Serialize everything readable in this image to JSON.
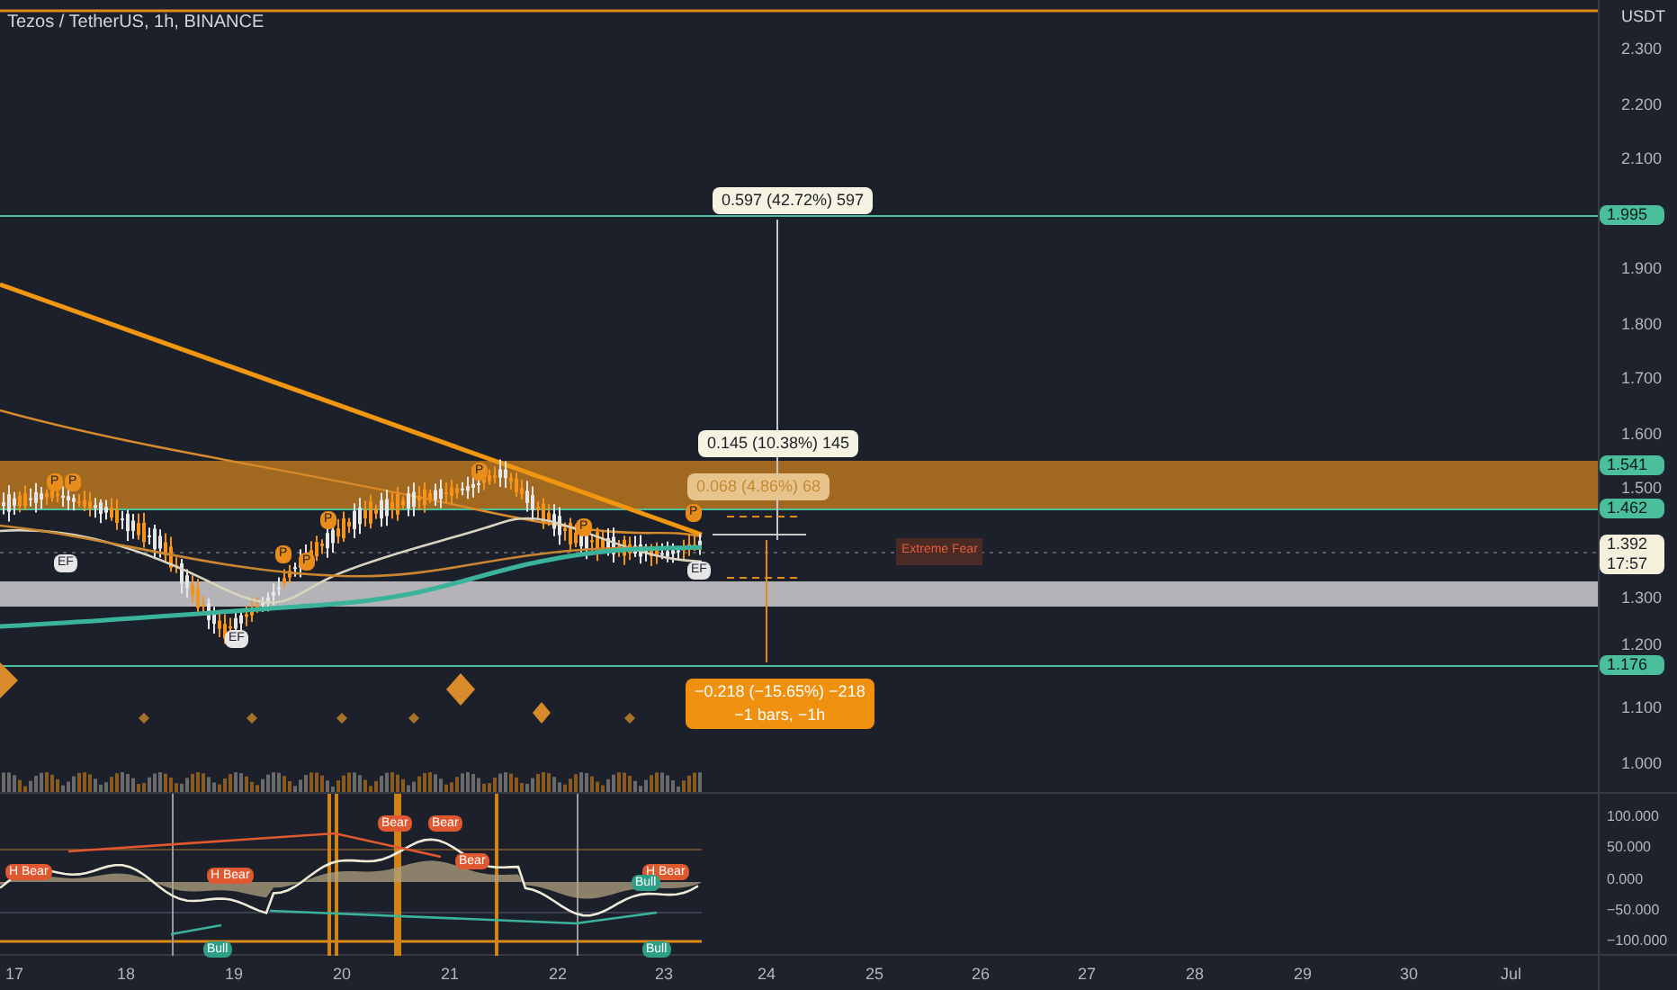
{
  "chart": {
    "title": "Tezos / TetherUS, 1h, BINANCE",
    "currency": "USDT",
    "price_ticks": [
      "2.300",
      "2.200",
      "2.100",
      "1.900",
      "1.800",
      "1.700",
      "1.600",
      "1.500",
      "1.300",
      "1.200",
      "1.100",
      "1.000"
    ],
    "price_labels": [
      {
        "text": "1.995",
        "kind": "level"
      },
      {
        "text": "1.541",
        "kind": "level"
      },
      {
        "text": "1.462",
        "kind": "level"
      },
      {
        "text": "1.392",
        "subtext": "17:57",
        "kind": "last"
      },
      {
        "text": "1.176",
        "kind": "level"
      }
    ],
    "measurements": [
      {
        "lines": [
          "0.597 (42.72%) 597"
        ],
        "kind": "light"
      },
      {
        "lines": [
          "0.145 (10.38%) 145"
        ],
        "kind": "light"
      },
      {
        "lines": [
          "0.068 (4.86%) 68"
        ],
        "kind": "faded"
      },
      {
        "lines": [
          "−0.218 (−15.65%) −218",
          "−1 bars, −1h"
        ],
        "kind": "orange"
      }
    ],
    "sentiment": "Extreme Fear",
    "markers": [
      {
        "text": "P",
        "kind": "p"
      },
      {
        "text": "P",
        "kind": "p"
      },
      {
        "text": "P",
        "kind": "p"
      },
      {
        "text": "P",
        "kind": "p"
      },
      {
        "text": "P",
        "kind": "p"
      },
      {
        "text": "P",
        "kind": "p"
      },
      {
        "text": "P",
        "kind": "p"
      },
      {
        "text": "P",
        "kind": "p"
      },
      {
        "text": "EF",
        "kind": "ef"
      },
      {
        "text": "EF",
        "kind": "ef"
      },
      {
        "text": "EF",
        "kind": "ef"
      }
    ]
  },
  "oscillator": {
    "ticks": [
      "100.000",
      "50.000",
      "0.000",
      "−50.000",
      "−100.000"
    ],
    "labels": [
      {
        "text": "H Bear",
        "kind": "bear"
      },
      {
        "text": "H Bear",
        "kind": "bear"
      },
      {
        "text": "Bear",
        "kind": "bear"
      },
      {
        "text": "Bear",
        "kind": "bear"
      },
      {
        "text": "Bear",
        "kind": "bear"
      },
      {
        "text": "H Bear",
        "kind": "bear"
      },
      {
        "text": "Bull",
        "kind": "bull"
      },
      {
        "text": "Bull",
        "kind": "bull"
      },
      {
        "text": "Bull",
        "kind": "bull"
      }
    ]
  },
  "time_axis": {
    "labels": [
      "17",
      "18",
      "19",
      "20",
      "21",
      "22",
      "23",
      "24",
      "25",
      "26",
      "27",
      "28",
      "29",
      "30",
      "Jul"
    ]
  }
}
